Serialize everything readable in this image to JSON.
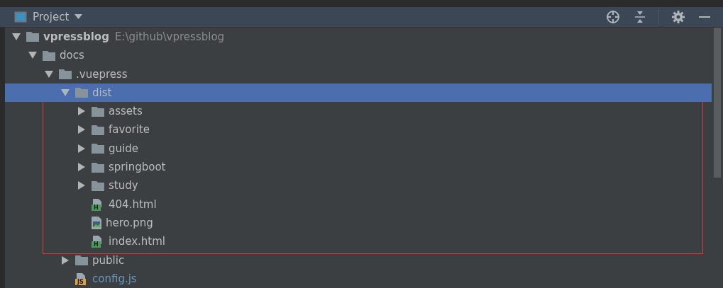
{
  "panel": {
    "title": "Project"
  },
  "tree": [
    {
      "kind": "project",
      "name": "vpressblog",
      "path": "E:\\github\\vpressblog",
      "expanded": true,
      "selected": false,
      "children": [
        {
          "kind": "folder",
          "name": "docs",
          "expanded": true,
          "selected": false,
          "children": [
            {
              "kind": "folder",
              "name": ".vuepress",
              "expanded": true,
              "selected": false,
              "children": [
                {
                  "kind": "folder",
                  "name": "dist",
                  "expanded": true,
                  "selected": true,
                  "children": [
                    {
                      "kind": "folder",
                      "name": "assets",
                      "expanded": false,
                      "selected": false
                    },
                    {
                      "kind": "folder",
                      "name": "favorite",
                      "expanded": false,
                      "selected": false
                    },
                    {
                      "kind": "folder",
                      "name": "guide",
                      "expanded": false,
                      "selected": false
                    },
                    {
                      "kind": "folder",
                      "name": "springboot",
                      "expanded": false,
                      "selected": false
                    },
                    {
                      "kind": "folder",
                      "name": "study",
                      "expanded": false,
                      "selected": false
                    },
                    {
                      "kind": "html_file",
                      "badge": "H",
                      "name": "404.html",
                      "modified": false,
                      "selected": false
                    },
                    {
                      "kind": "image_file",
                      "name": "hero.png",
                      "modified": false,
                      "selected": false
                    },
                    {
                      "kind": "html_file",
                      "badge": "H",
                      "name": "index.html",
                      "modified": false,
                      "selected": false
                    }
                  ]
                },
                {
                  "kind": "folder",
                  "name": "public",
                  "expanded": false,
                  "selected": false
                },
                {
                  "kind": "js_file",
                  "badge": "JS",
                  "name": "config.js",
                  "modified": true,
                  "selected": false
                }
              ]
            }
          ]
        }
      ]
    }
  ]
}
